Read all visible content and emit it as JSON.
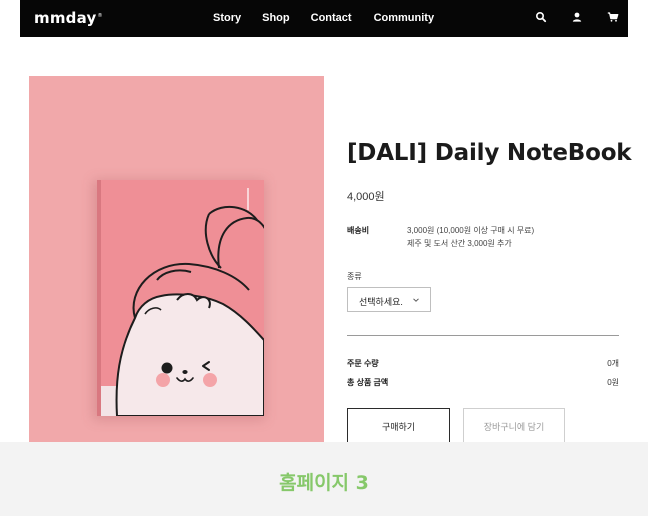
{
  "header": {
    "logo": "mmday",
    "logo_mark": "®",
    "nav": [
      {
        "label": "Story"
      },
      {
        "label": "Shop"
      },
      {
        "label": "Contact"
      },
      {
        "label": "Community"
      }
    ],
    "icons": [
      "search-icon",
      "user-icon",
      "cart-icon"
    ]
  },
  "product": {
    "title": "[DALI] Daily NoteBook",
    "price": "4,000원",
    "shipping": {
      "label": "배송비",
      "line1": "3,000원 (10,000원 이상 구매 시 무료)",
      "line2": "제주 및 도서 산간 3,000원 추가"
    },
    "option": {
      "label": "종류",
      "selected": "선택하세요."
    },
    "quantity": {
      "label": "주문 수량",
      "value": "0개"
    },
    "total": {
      "label": "총 상품 금액",
      "value": "0원"
    },
    "buttons": {
      "buy": "구매하기",
      "cart": "장바구니에 담기"
    }
  },
  "banner": {
    "text": "홈페이지 3"
  },
  "colors": {
    "header_bg": "#060606",
    "photo_bg": "#f1a8aa",
    "book_cover": "#ef8f96",
    "banner_text": "#86c86a"
  }
}
